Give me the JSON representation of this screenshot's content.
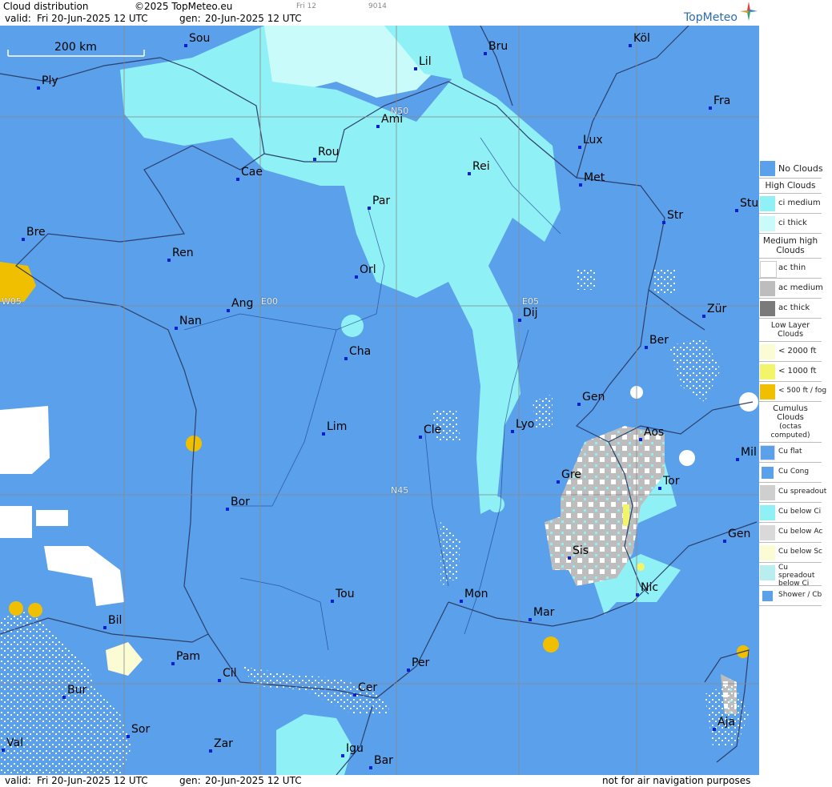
{
  "header": {
    "title": "Cloud distribution",
    "copyright": "©2025 TopMeteo.eu",
    "small1": "Fri 12",
    "small2": "9014",
    "valid_label": "valid:",
    "valid_value": "Fri  20-Jun-2025  12 UTC",
    "gen_label": "gen:",
    "gen_value": "20-Jun-2025 12 UTC",
    "logo": "TopMeteo"
  },
  "footer": {
    "valid_label": "valid:",
    "valid_value": "Fri  20-Jun-2025  12 UTC",
    "gen_label": "gen:",
    "gen_value": "20-Jun-2025 12 UTC",
    "disclaimer": "not for air navigation purposes"
  },
  "scale": {
    "label": "200 km"
  },
  "grid_labels": [
    "N50",
    "N45",
    "E00",
    "E05",
    "W05"
  ],
  "cities": [
    {
      "name": "Sou"
    },
    {
      "name": "Bru"
    },
    {
      "name": "Köl"
    },
    {
      "name": "Ply"
    },
    {
      "name": "Lil"
    },
    {
      "name": "Ami"
    },
    {
      "name": "Fra"
    },
    {
      "name": "Lux"
    },
    {
      "name": "Rou"
    },
    {
      "name": "Cae"
    },
    {
      "name": "Rei"
    },
    {
      "name": "Met"
    },
    {
      "name": "Par"
    },
    {
      "name": "Stu"
    },
    {
      "name": "Str"
    },
    {
      "name": "Bre"
    },
    {
      "name": "Ren"
    },
    {
      "name": "Orl"
    },
    {
      "name": "Ang"
    },
    {
      "name": "Nan"
    },
    {
      "name": "Dij"
    },
    {
      "name": "Zür"
    },
    {
      "name": "Ber"
    },
    {
      "name": "Cha"
    },
    {
      "name": "Gen"
    },
    {
      "name": "Lim"
    },
    {
      "name": "Cle"
    },
    {
      "name": "Lyo"
    },
    {
      "name": "Aos"
    },
    {
      "name": "Mil"
    },
    {
      "name": "Gre"
    },
    {
      "name": "Tor"
    },
    {
      "name": "Bor"
    },
    {
      "name": "Gen"
    },
    {
      "name": "Sis"
    },
    {
      "name": "Nic"
    },
    {
      "name": "Tou"
    },
    {
      "name": "Mon"
    },
    {
      "name": "Mar"
    },
    {
      "name": "Bil"
    },
    {
      "name": "Pam"
    },
    {
      "name": "Per"
    },
    {
      "name": "Cil"
    },
    {
      "name": "Cer"
    },
    {
      "name": "Bur"
    },
    {
      "name": "Sor"
    },
    {
      "name": "Val"
    },
    {
      "name": "Zar"
    },
    {
      "name": "Igu"
    },
    {
      "name": "Bar"
    },
    {
      "name": "Aja"
    }
  ],
  "legend": {
    "no_clouds": "No Clouds",
    "high_title": "High Clouds",
    "ci_medium": "ci medium",
    "ci_thick": "ci thick",
    "medium_title": "Medium high Clouds",
    "ac_thin": "ac thin",
    "ac_medium": "ac medium",
    "ac_thick": "ac thick",
    "low_title": "Low Layer Clouds",
    "low_2000": "< 2000 ft",
    "low_1000": "< 1000 ft",
    "low_500": "< 500 ft / fog",
    "cu_title": "Cumulus Clouds",
    "cu_subtitle": "(octas computed)",
    "cu_flat": "Cu flat",
    "cu_cong": "Cu Cong",
    "cu_spread": "Cu spreadout",
    "cu_below_ci": "Cu below Ci",
    "cu_below_ac": "Cu below Ac",
    "cu_below_sc": "Cu below Sc",
    "cu_spread_ci": "Cu spreadout below Ci",
    "shower": "Shower / Cb"
  },
  "colors": {
    "sea_land": "#5aa0ea",
    "ci_medium": "#8ff0f6",
    "ci_thick": "#c9fbfb",
    "ac_thin": "#ffffff",
    "ac_medium": "#bdbdbd",
    "ac_thick": "#7a7a7a",
    "low_2000": "#fbfcd3",
    "low_1000": "#f2f56a",
    "low_500": "#f0c000",
    "city_dot": "#0a1fd0"
  }
}
